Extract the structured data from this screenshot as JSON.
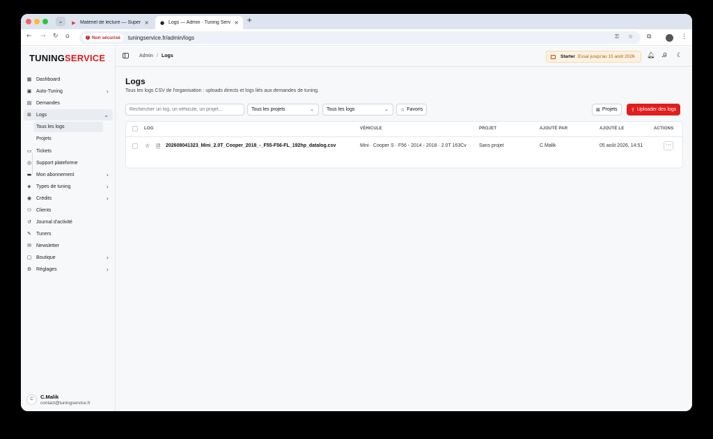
{
  "browser": {
    "tabs": [
      {
        "title": "Matériel de lecture — Supera",
        "active": false
      },
      {
        "title": "Logs — Admin · Tuning Servic",
        "active": true
      }
    ],
    "new_tab": "+",
    "tabs_menu_icon": "⌄",
    "security_label": "Non sécurisé",
    "url": "tuningservice.fr/admin/logs"
  },
  "app": {
    "logo_main": "TUNING",
    "logo_accent": "SERVICE",
    "brand_color": "#e11d1d"
  },
  "sidebar": {
    "items": [
      {
        "label": "Dashboard",
        "icon": "grid-icon",
        "chevron": ""
      },
      {
        "label": "Auto-Tuning",
        "icon": "cpu-icon",
        "chevron": "›"
      },
      {
        "label": "Demandes",
        "icon": "clipboard-icon",
        "chevron": ""
      },
      {
        "label": "Logs",
        "icon": "network-icon",
        "chevron": "⌄"
      },
      {
        "label": "Tickets",
        "icon": "ticket-icon",
        "chevron": ""
      },
      {
        "label": "Support plateforme",
        "icon": "lifebuoy-icon",
        "chevron": ""
      },
      {
        "label": "Mon abonnement",
        "icon": "card-icon",
        "chevron": "›"
      },
      {
        "label": "Types de tuning",
        "icon": "tag-icon",
        "chevron": "›"
      },
      {
        "label": "Crédits",
        "icon": "coins-icon",
        "chevron": "›"
      },
      {
        "label": "Clients",
        "icon": "users-icon",
        "chevron": ""
      },
      {
        "label": "Journal d'activité",
        "icon": "history-icon",
        "chevron": ""
      },
      {
        "label": "Tuners",
        "icon": "wrench-icon",
        "chevron": ""
      },
      {
        "label": "Newsletter",
        "icon": "mail-icon",
        "chevron": ""
      },
      {
        "label": "Boutique",
        "icon": "shop-icon",
        "chevron": "›"
      },
      {
        "label": "Réglages",
        "icon": "gear-icon",
        "chevron": "›"
      }
    ],
    "subitems": [
      {
        "label": "Tous les logs"
      },
      {
        "label": "Projets"
      }
    ],
    "user": {
      "initial": "C",
      "name": "C.Malik",
      "email": "contact@tuningservice.fr"
    }
  },
  "header": {
    "breadcrumb": [
      "Admin",
      "/",
      "Logs"
    ],
    "plan_name": "Starter",
    "plan_text": "Essai jusqu'au 15 août 2026"
  },
  "main": {
    "title": "Logs",
    "subtitle": "Tous les logs CSV de l'organisation : uploads directs et logs liés aux demandes de tuning.",
    "search_placeholder": "Rechercher un log, un véhicule, un projet...",
    "filter_projects": "Tous les projets",
    "filter_logs": "Tous les logs",
    "favorites_label": "Favoris",
    "projects_button": "Projets",
    "upload_button": "Uploader des logs",
    "table": {
      "headers": [
        "LOG",
        "VÉHICULE",
        "PROJET",
        "AJOUTÉ PAR",
        "AJOUTÉ LE",
        "ACTIONS"
      ],
      "rows": [
        {
          "file": "202608041323_Mini_2.0T_Cooper_2018_-_F55-F56-FL_192hp_datalog.csv",
          "vehicle": "Mini · Cooper S · F56 - 2014 - 2018 · 2.0T 163Cv",
          "project": "Sans projet",
          "added_by": "C.Malik",
          "added_on": "05 août 2026, 14:51",
          "actions": "···"
        }
      ]
    }
  }
}
